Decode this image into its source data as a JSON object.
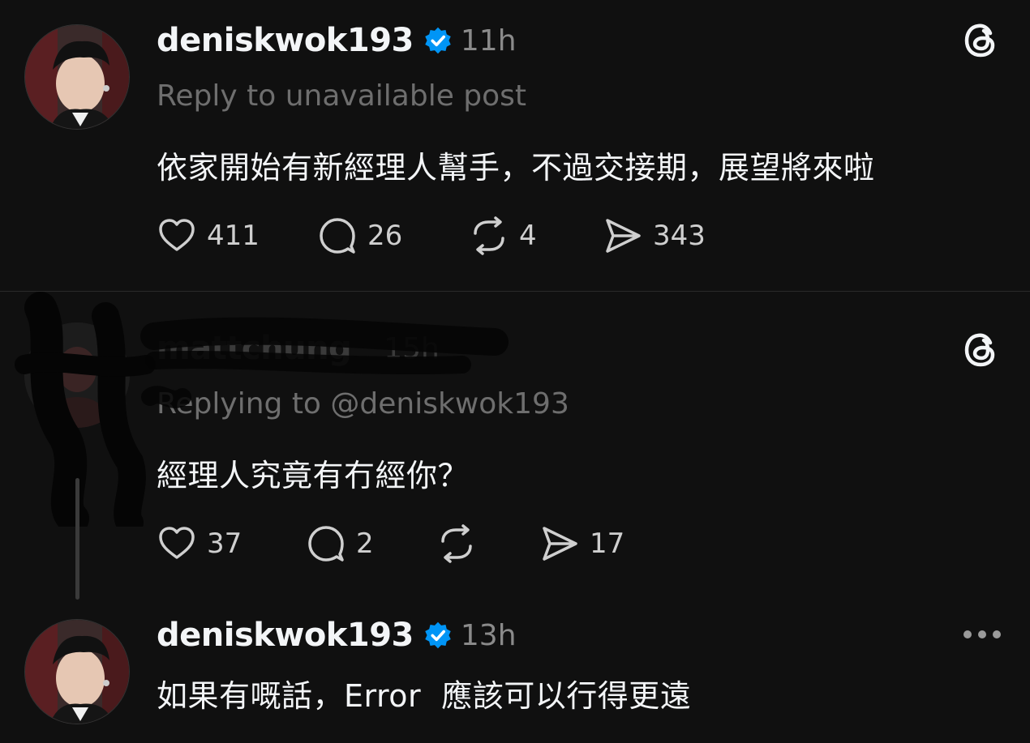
{
  "posts": [
    {
      "username": "deniskwok193",
      "time": "11h",
      "meta": "Reply to unavailable post",
      "text": "依家開始有新經理人幫手，不過交接期，展望將來啦",
      "likes": "411",
      "replies": "26",
      "reposts": "4",
      "shares": "343"
    },
    {
      "username": "mattchung",
      "time": "15h",
      "meta": "Replying to @deniskwok193",
      "text": "經理人究竟有冇經你？",
      "likes": "37",
      "replies": "2",
      "reposts": "",
      "shares": "17"
    },
    {
      "username": "deniskwok193",
      "time": "13h",
      "text": "如果有嘅話，Error  應該可以行得更遠"
    }
  ],
  "icons": {
    "verified": "verified-badge-icon",
    "like": "heart-icon",
    "reply": "comment-bubble-icon",
    "repost": "repost-icon",
    "share": "send-icon",
    "app": "threads-logo-icon",
    "more": "more-dots-icon"
  },
  "colors": {
    "background": "#101010",
    "text": "#f3f5f7",
    "secondary": "#8a8a8a",
    "verified": "#0095f6"
  }
}
